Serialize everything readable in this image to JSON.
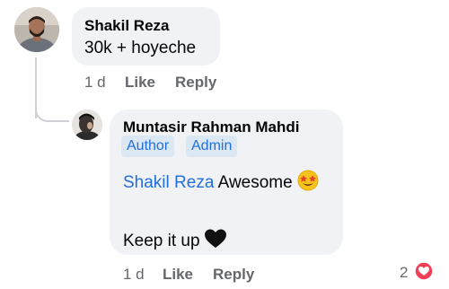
{
  "comment": {
    "author": "Shakil Reza",
    "text": "30k + hoyeche",
    "time": "1 d",
    "like_label": "Like",
    "reply_label": "Reply"
  },
  "reply": {
    "author": "Muntasir Rahman Mahdi",
    "badges": [
      "Author",
      "Admin"
    ],
    "mention": "Shakil Reza",
    "line1_text": "Awesome",
    "line1_emoji": "star-struck-emoji",
    "line2_text": "Keep it up",
    "line2_emoji": "black-heart-emoji",
    "time": "1 d",
    "like_label": "Like",
    "reply_label": "Reply",
    "reaction_count": "2",
    "reaction_icon": "love-reaction-icon"
  },
  "colors": {
    "bubble_bg": "#f0f2f5",
    "mention": "#216fdb",
    "badge_bg": "#dbe7f2",
    "meta": "#65676b",
    "love_reaction": "#f33e58"
  }
}
